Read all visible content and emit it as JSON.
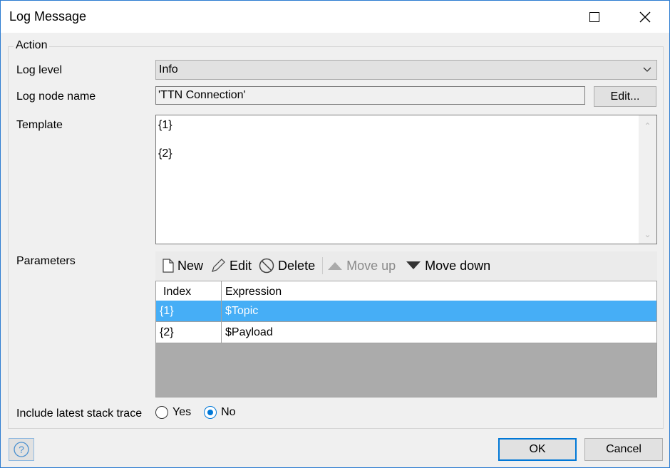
{
  "window": {
    "title": "Log Message"
  },
  "group": {
    "title": "Action"
  },
  "log_level": {
    "label": "Log level",
    "value": "Info"
  },
  "log_node": {
    "label": "Log node name",
    "value": "'TTN Connection'",
    "edit_button": "Edit..."
  },
  "template": {
    "label": "Template",
    "lines": [
      "{1}",
      "",
      "{2}"
    ]
  },
  "parameters": {
    "label": "Parameters",
    "toolbar": {
      "new": "New",
      "edit": "Edit",
      "delete": "Delete",
      "move_up": "Move up",
      "move_down": "Move down"
    },
    "columns": [
      "Index",
      "Expression"
    ],
    "rows": [
      {
        "index": "{1}",
        "expression": "$Topic",
        "selected": true
      },
      {
        "index": "{2}",
        "expression": "$Payload",
        "selected": false
      }
    ]
  },
  "stack_trace": {
    "label": "Include latest stack trace",
    "yes": "Yes",
    "no": "No",
    "selected": "No"
  },
  "footer": {
    "ok": "OK",
    "cancel": "Cancel"
  },
  "colors": {
    "selection": "#46aef6",
    "window_border": "#2b7bd1"
  }
}
